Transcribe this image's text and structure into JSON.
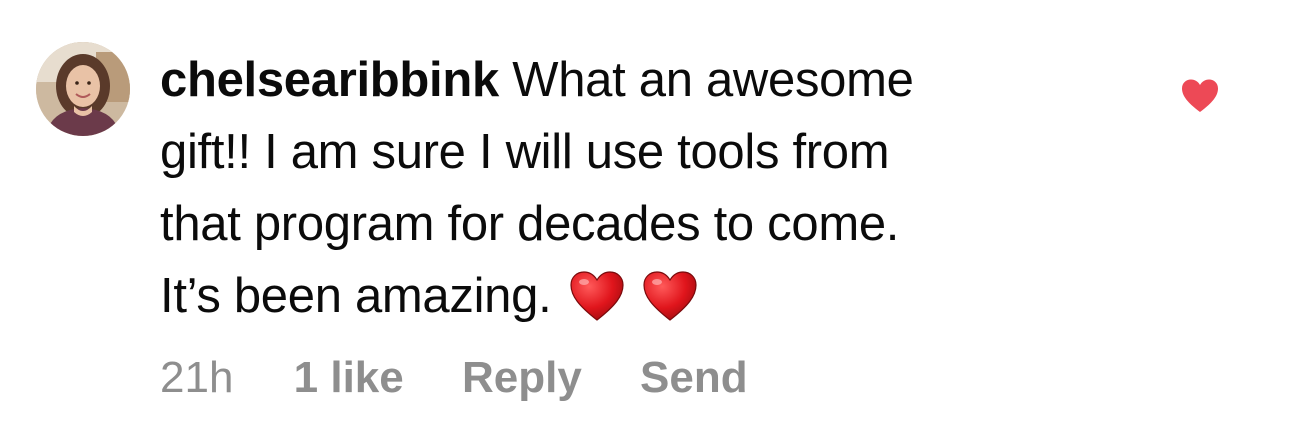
{
  "comment": {
    "username": "chelsearibbink",
    "text_lines": [
      "What an awesome",
      "gift!! I am sure I will use tools from",
      "that program for decades to come.",
      "It’s been amazing."
    ],
    "trailing_emoji": [
      "red-heart",
      "red-heart"
    ]
  },
  "meta": {
    "timestamp": "21h",
    "likes": "1 like",
    "reply_label": "Reply",
    "send_label": "Send"
  },
  "like_button": {
    "icon": "heart-filled-icon",
    "liked": true,
    "color": "#ed4956"
  },
  "colors": {
    "text": "#0b0b0b",
    "meta_text": "#8e8e8e",
    "heart": "#ed4956"
  }
}
